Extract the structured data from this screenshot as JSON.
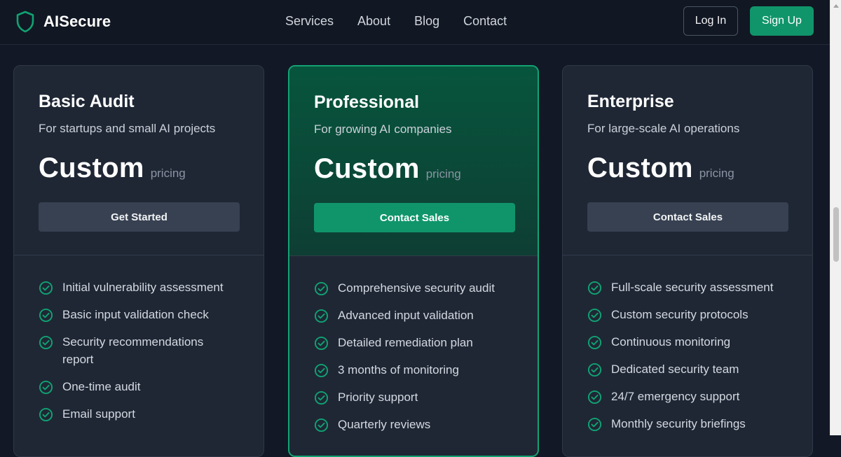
{
  "brand": {
    "name": "AISecure",
    "accent": "#10956a"
  },
  "nav": {
    "links": [
      "Services",
      "About",
      "Blog",
      "Contact"
    ],
    "login_label": "Log In",
    "signup_label": "Sign Up"
  },
  "plans": [
    {
      "name": "Basic Audit",
      "subtitle": "For startups and small AI projects",
      "price": "Custom",
      "price_unit": "pricing",
      "cta": "Get Started",
      "highlighted": false,
      "features": [
        "Initial vulnerability assessment",
        "Basic input validation check",
        "Security recommendations report",
        "One-time audit",
        "Email support"
      ]
    },
    {
      "name": "Professional",
      "subtitle": "For growing AI companies",
      "price": "Custom",
      "price_unit": "pricing",
      "cta": "Contact Sales",
      "highlighted": true,
      "features": [
        "Comprehensive security audit",
        "Advanced input validation",
        "Detailed remediation plan",
        "3 months of monitoring",
        "Priority support",
        "Quarterly reviews"
      ]
    },
    {
      "name": "Enterprise",
      "subtitle": "For large-scale AI operations",
      "price": "Custom",
      "price_unit": "pricing",
      "cta": "Contact Sales",
      "highlighted": false,
      "features": [
        "Full-scale security assessment",
        "Custom security protocols",
        "Continuous monitoring",
        "Dedicated security team",
        "24/7 emergency support",
        "Monthly security briefings"
      ]
    }
  ],
  "icons": {
    "logo": "shield-icon",
    "feature": "check-circle-icon"
  }
}
